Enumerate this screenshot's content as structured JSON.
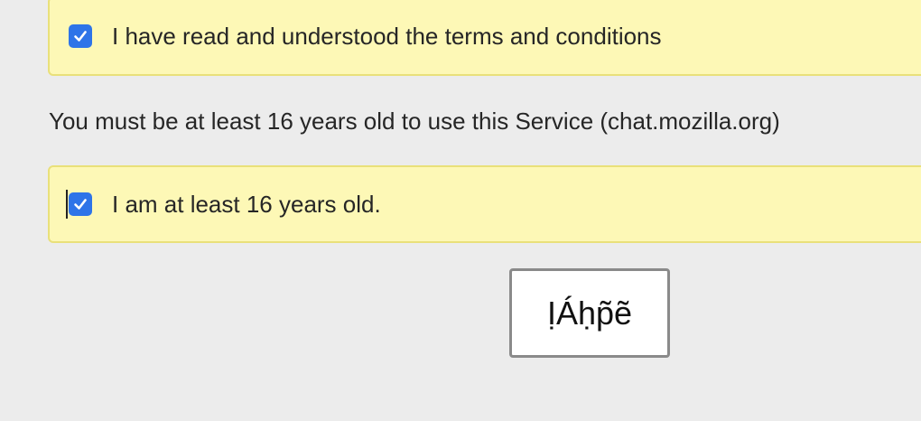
{
  "terms": {
    "checked": true,
    "label": "I have read and understood the terms and conditions"
  },
  "age_notice": "You must be at least 16 years old to use this Service (chat.mozilla.org)",
  "age_check": {
    "checked": true,
    "label": "I am at least 16 years old."
  },
  "submit_button": {
    "label": "ỊÁḥp̃ẽ"
  },
  "colors": {
    "background": "#ececec",
    "panel_background": "#fdf8b6",
    "panel_border": "#e9e07a",
    "checkbox": "#2e74e8"
  },
  "icons": {
    "checkbox_checked": "checkmark-icon"
  }
}
